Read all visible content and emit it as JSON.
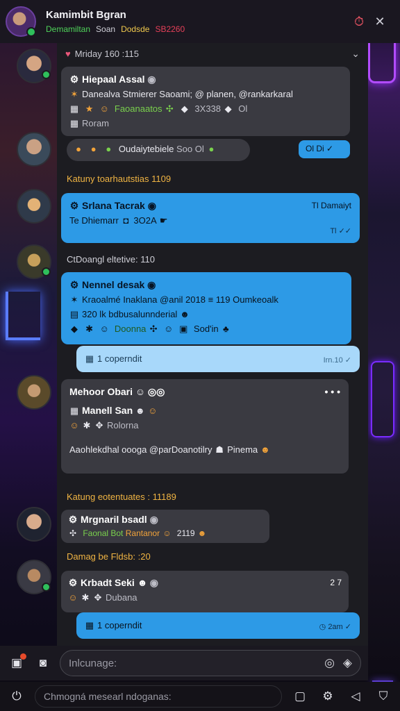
{
  "header": {
    "title": "Kamimbit Bgran",
    "sub_green": "Demamiltan",
    "sub_grey": "Soan",
    "sub_yellow": "Dodsde",
    "sub_red": "SB2260"
  },
  "date_bar": {
    "label": "Mriday 160 :115"
  },
  "messages": {
    "m1": {
      "name": "Hiepaal Assal",
      "line1": "Danealva Stmierer Saoami; @ planen, @rankarkaral",
      "line2_a": "Faoanaatos",
      "line2_b": "3X338",
      "line2_c": "Ol",
      "line3": "Roram"
    },
    "m2": {
      "text": "Oudaiytebiele",
      "extra": "Soo Ol"
    },
    "m2_reply": {
      "text": "Ol Di"
    },
    "divider1": "Katuny toarhautstias 1109",
    "m3": {
      "name": "Srlana Tacrak",
      "text": "Te Dhiemarr",
      "extra": "3O2A",
      "time_top": "Tl Damaiyt",
      "time": "Tl"
    },
    "divider2": "CtDoangl eltetive: 110",
    "m4": {
      "name": "Nennel desak",
      "line1": "Kraoalmé Inaklana @anil 2018 ≡ 119 Oumkeoalk",
      "line2": "320 lk bdbusalunnderial",
      "line3_a": "Doonna",
      "line3_b": "Sod'in"
    },
    "m5": {
      "text": "1 coperndit",
      "time": "Irn.10"
    },
    "m6": {
      "name": "Mehoor Obari",
      "line1": "Manell San",
      "line2": "Rolorna",
      "line3": "Aaohlekdhal oooga @parDoanotilry",
      "line3_b": "Pinema"
    },
    "divider3": "Katung eotentuates : 11189",
    "m7": {
      "name": "Mrgnaril bsadl",
      "a": "Faonal Bot",
      "b": "Rantanor",
      "c": "2119"
    },
    "divider4": "Damag be Fldsb: :20",
    "m8": {
      "name": "Krbadt Seki",
      "line2": "Dubana",
      "time": "2 7"
    },
    "m9": {
      "text": "1 coperndit",
      "time": "2am"
    }
  },
  "input": {
    "placeholder": "Inlcunage:"
  },
  "bottom": {
    "hint": "Chmogná mesearl ndoganas:"
  }
}
